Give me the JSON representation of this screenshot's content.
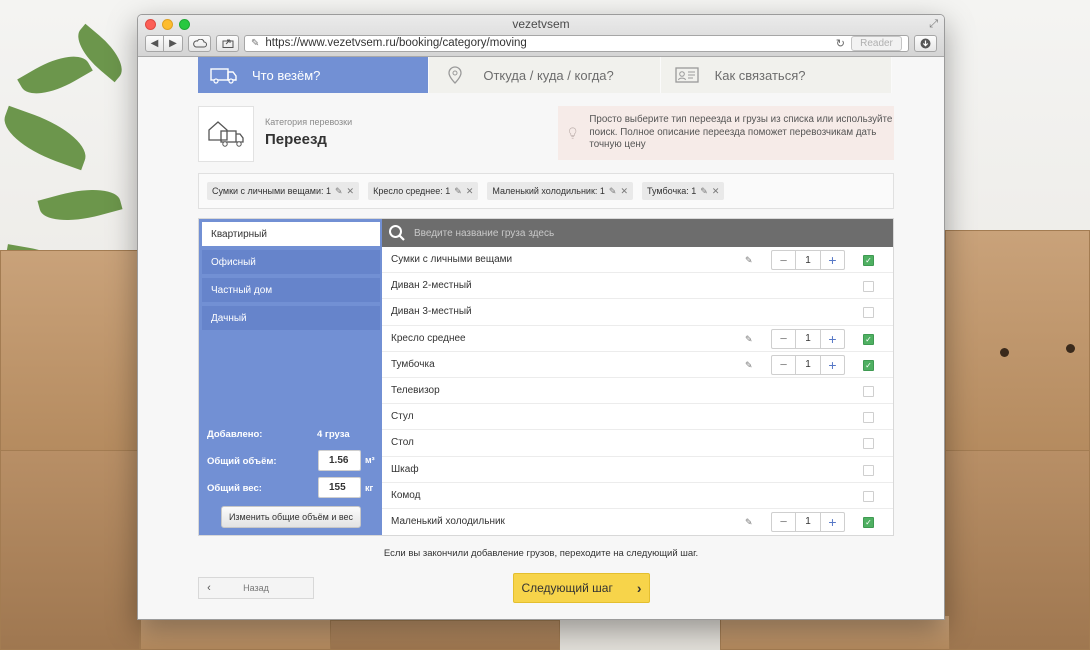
{
  "browser": {
    "window_title": "vezetvsem",
    "url": "https://www.vezetvsem.ru/booking/category/moving",
    "reader_label": "Reader"
  },
  "steps": [
    {
      "label": "Что везём?",
      "icon": "truck-icon",
      "active": true
    },
    {
      "label": "Откуда / куда / когда?",
      "icon": "map-pin-icon",
      "active": false
    },
    {
      "label": "Как связаться?",
      "icon": "contact-card-icon",
      "active": false
    }
  ],
  "category": {
    "caption": "Категория перевозки",
    "title": "Переезд",
    "icon": "moving-truck-icon"
  },
  "hint": {
    "icon": "lightbulb-icon",
    "text": "Просто выберите тип переезда и грузы из списка или используйте поиск. Полное описание переезда поможет перевозчикам дать точную цену"
  },
  "chips": [
    {
      "label": "Сумки с личными вещами: 1"
    },
    {
      "label": "Кресло среднее: 1"
    },
    {
      "label": "Маленький холодильник: 1"
    },
    {
      "label": "Тумбочка: 1"
    }
  ],
  "sidebar": {
    "items": [
      {
        "label": "Квартирный",
        "active": true
      },
      {
        "label": "Офисный",
        "active": false
      },
      {
        "label": "Частный дом",
        "active": false
      },
      {
        "label": "Дачный",
        "active": false
      }
    ],
    "added_label": "Добавлено:",
    "added_value": "4 груза",
    "volume_label": "Общий объём:",
    "volume_value": "1.56",
    "volume_unit": "м³",
    "weight_label": "Общий вес:",
    "weight_value": "155",
    "weight_unit": "кг",
    "change_button": "Изменить общие объём и вес"
  },
  "search": {
    "placeholder": "Введите название груза здесь"
  },
  "items": [
    {
      "name": "Сумки с личными вещами",
      "selected": true,
      "qty": "1"
    },
    {
      "name": "Диван 2-местный",
      "selected": false
    },
    {
      "name": "Диван 3-местный",
      "selected": false
    },
    {
      "name": "Кресло среднее",
      "selected": true,
      "qty": "1"
    },
    {
      "name": "Тумбочка",
      "selected": true,
      "qty": "1"
    },
    {
      "name": "Телевизор",
      "selected": false
    },
    {
      "name": "Стул",
      "selected": false
    },
    {
      "name": "Стол",
      "selected": false
    },
    {
      "name": "Шкаф",
      "selected": false
    },
    {
      "name": "Комод",
      "selected": false
    },
    {
      "name": "Маленький холодильник",
      "selected": true,
      "qty": "1"
    }
  ],
  "footer": {
    "note": "Если вы закончили добавление грузов, переходите на следующий шаг.",
    "back_label": "Назад",
    "next_label": "Следующий шаг"
  },
  "colors": {
    "accent_blue": "#7290d4",
    "next_yellow": "#f7d44a",
    "check_green": "#4fb062"
  }
}
